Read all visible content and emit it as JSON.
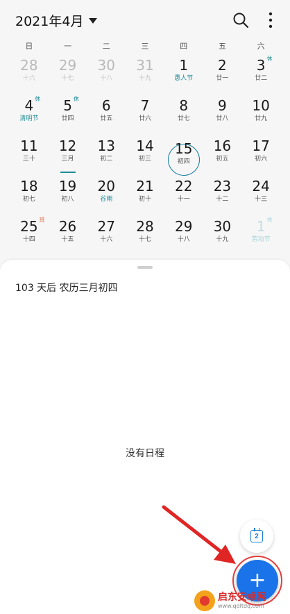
{
  "header": {
    "month_title": "2021年4月"
  },
  "weekdays": [
    "日",
    "一",
    "二",
    "三",
    "四",
    "五",
    "六"
  ],
  "calendar": [
    {
      "d": "28",
      "s": "十六",
      "dim": true
    },
    {
      "d": "29",
      "s": "十七",
      "dim": true
    },
    {
      "d": "30",
      "s": "十八",
      "dim": true
    },
    {
      "d": "31",
      "s": "十九",
      "dim": true
    },
    {
      "d": "1",
      "s": "愚人节",
      "teal": true
    },
    {
      "d": "2",
      "s": "廿一"
    },
    {
      "d": "3",
      "s": "廿二",
      "badge": "休"
    },
    {
      "d": "4",
      "s": "清明节",
      "teal": true,
      "badge": "休"
    },
    {
      "d": "5",
      "s": "廿四",
      "badge": "休"
    },
    {
      "d": "6",
      "s": "廿五"
    },
    {
      "d": "7",
      "s": "廿六"
    },
    {
      "d": "8",
      "s": "廿七"
    },
    {
      "d": "9",
      "s": "廿八"
    },
    {
      "d": "10",
      "s": "廿九"
    },
    {
      "d": "11",
      "s": "三十"
    },
    {
      "d": "12",
      "s": "三月",
      "underline": true
    },
    {
      "d": "13",
      "s": "初二"
    },
    {
      "d": "14",
      "s": "初三"
    },
    {
      "d": "15",
      "s": "初四",
      "today": true
    },
    {
      "d": "16",
      "s": "初五"
    },
    {
      "d": "17",
      "s": "初六"
    },
    {
      "d": "18",
      "s": "初七"
    },
    {
      "d": "19",
      "s": "初八"
    },
    {
      "d": "20",
      "s": "谷雨",
      "teal": true
    },
    {
      "d": "21",
      "s": "初十"
    },
    {
      "d": "22",
      "s": "十一"
    },
    {
      "d": "23",
      "s": "十二"
    },
    {
      "d": "24",
      "s": "十三"
    },
    {
      "d": "25",
      "s": "十四",
      "badge": "班",
      "badge_type": "ban"
    },
    {
      "d": "26",
      "s": "十五"
    },
    {
      "d": "27",
      "s": "十六"
    },
    {
      "d": "28",
      "s": "十七"
    },
    {
      "d": "29",
      "s": "十八"
    },
    {
      "d": "30",
      "s": "十九"
    },
    {
      "d": "1",
      "s": "劳动节",
      "dimteal": true,
      "badge": "休"
    }
  ],
  "agenda": {
    "days_after": "103 天后 农历三月初四",
    "empty_text": "没有日程"
  },
  "fab": {
    "today_date": "2",
    "add_symbol": "+"
  },
  "watermark": {
    "name": "启东安卓网",
    "url": "www.qdltdq.com"
  },
  "colors": {
    "accent": "#1a73e8",
    "teal": "#1e8c96",
    "annotation_red": "#e43d3d"
  }
}
